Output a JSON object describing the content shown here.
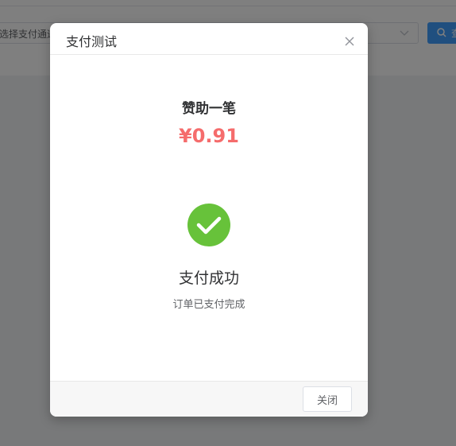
{
  "background": {
    "select_placeholder": "选择支付通道",
    "search_button_label": "查"
  },
  "dialog": {
    "title": "支付测试",
    "donate_title": "赞助一笔",
    "amount": "¥0.91",
    "status": {
      "title": "支付成功",
      "subtitle": "订单已支付完成"
    },
    "close_button_label": "关闭"
  },
  "colors": {
    "amount": "#f56c6c",
    "success": "#67c23a",
    "primary": "#409eff"
  }
}
